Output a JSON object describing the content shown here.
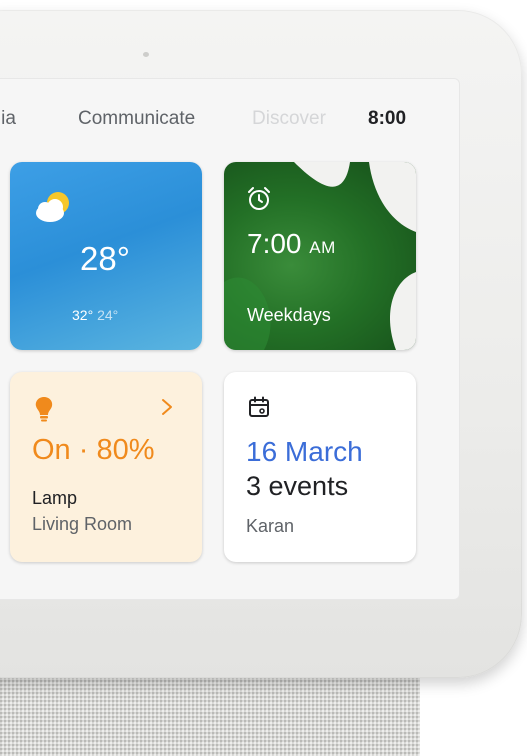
{
  "tabs": {
    "media": "edia",
    "communicate": "Communicate",
    "discover": "Discover",
    "clock": "8:00"
  },
  "weather": {
    "icon": "partly-sunny-icon",
    "temperature": "28°",
    "high": "32°",
    "low": "24°"
  },
  "alarm": {
    "icon": "alarm-clock-icon",
    "time": "7:00",
    "ampm": "AM",
    "schedule": "Weekdays"
  },
  "lamp": {
    "icon": "lightbulb-icon",
    "state": "On · 80%",
    "name": "Lamp",
    "room": "Living Room",
    "chevron_icon": "chevron-right-icon"
  },
  "calendar": {
    "icon": "calendar-icon",
    "date": "16 March",
    "events": "3 events",
    "owner": "Karan"
  },
  "colors": {
    "lamp_accent": "#f08a1c",
    "calendar_accent": "#3b6dd8",
    "weather_bg": "#2b8fd8",
    "alarm_bg": "#237026"
  }
}
